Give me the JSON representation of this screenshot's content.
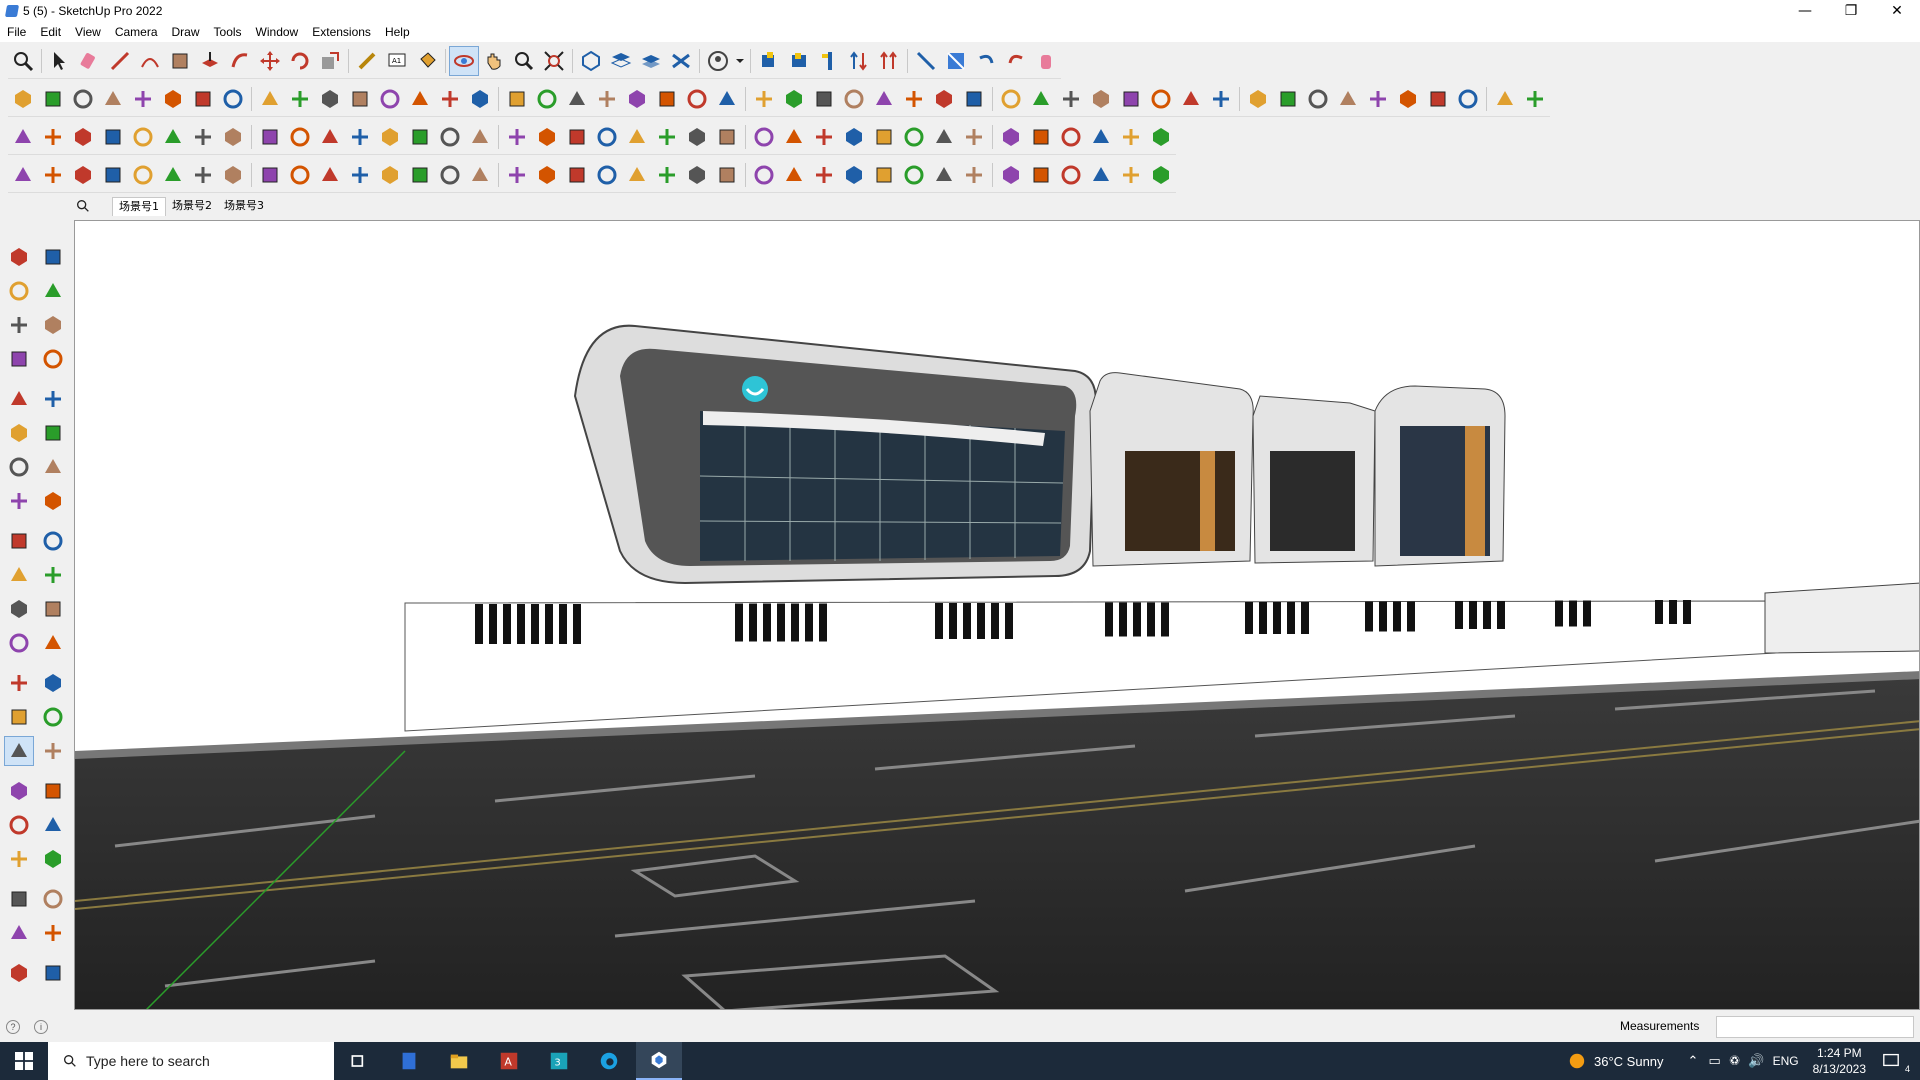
{
  "window": {
    "title": "5 (5) - SketchUp Pro 2022"
  },
  "menu": [
    "File",
    "Edit",
    "View",
    "Camera",
    "Draw",
    "Tools",
    "Window",
    "Extensions",
    "Help"
  ],
  "scenes": {
    "tabs": [
      "场景号1",
      "场景号2",
      "场景号3"
    ],
    "active_index": 0
  },
  "status": {
    "measurements_label": "Measurements",
    "measurements_value": ""
  },
  "taskbar": {
    "search_placeholder": "Type here to search",
    "weather": "36°C  Sunny",
    "language": "ENG",
    "time": "1:24 PM",
    "date": "8/13/2023",
    "notification_count": "4"
  },
  "colors": {
    "accent": "#3a7bd5",
    "taskbar": "#1c2a3a",
    "toolbar": "#f0f0f0",
    "road": "#2b2b2b"
  }
}
